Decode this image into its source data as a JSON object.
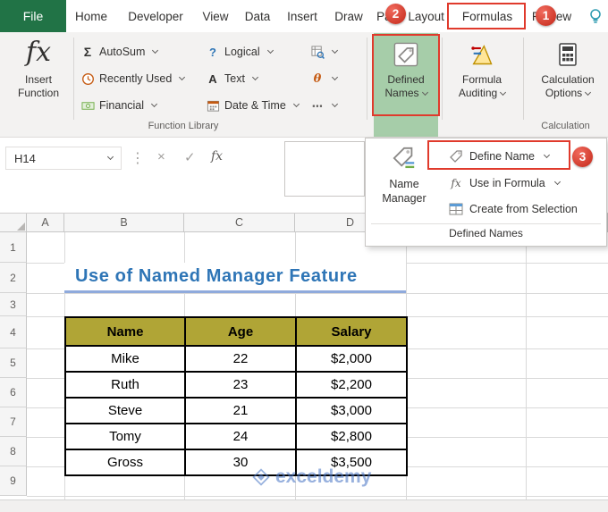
{
  "tab_bar": {
    "file_tab": "File",
    "tabs": [
      "Home",
      "Developer",
      "View",
      "Data",
      "Insert",
      "Draw",
      "Page Layout",
      "Formulas",
      "Review"
    ]
  },
  "ribbon": {
    "insert_function": {
      "glyph": "fx",
      "label": "Insert Function"
    },
    "function_library": {
      "group_label": "Function Library",
      "autosum": {
        "glyph": "Σ",
        "label": "AutoSum"
      },
      "recently_used": {
        "label": "Recently Used"
      },
      "financial": {
        "label": "Financial"
      },
      "logical": {
        "glyph": "?",
        "label": "Logical"
      },
      "text": {
        "glyph": "A",
        "label": "Text"
      },
      "date_time": {
        "label": "Date & Time"
      },
      "math_trig": {
        "glyph": "θ"
      },
      "more_functions": {
        "glyph": "⋯"
      }
    },
    "defined_names": {
      "line1": "Defined",
      "line2": "Names"
    },
    "formula_auditing": {
      "line1": "Formula",
      "line2": "Auditing"
    },
    "calculation_options": {
      "line1": "Calculation",
      "line2": "Options"
    },
    "calculation_group_label": "Calculation"
  },
  "formula_bar": {
    "name_box_value": "H14",
    "separator_glyph": "⋮",
    "cancel_glyph": "×",
    "enter_glyph": "✓",
    "fx_glyph": "fx"
  },
  "defined_names_menu": {
    "name_manager": {
      "line1": "Name",
      "line2": "Manager"
    },
    "define_name": {
      "label": "Define Name"
    },
    "use_in_formula": {
      "label": "Use in Formula",
      "glyph": "fx"
    },
    "create_from_selection": {
      "label": "Create from Selection"
    },
    "group_label": "Defined Names"
  },
  "annotations": {
    "step1": "1",
    "step2": "2",
    "step3": "3"
  },
  "worksheet": {
    "column_headers": [
      "A",
      "B",
      "C",
      "D"
    ],
    "row_headers": [
      "1",
      "2",
      "3",
      "4",
      "5",
      "6",
      "7",
      "8",
      "9"
    ],
    "title": "Use of Named Manager Feature",
    "table": {
      "headers": [
        "Name",
        "Age",
        "Salary"
      ],
      "rows": [
        [
          "Mike",
          "22",
          "$2,000"
        ],
        [
          "Ruth",
          "23",
          "$2,200"
        ],
        [
          "Steve",
          "21",
          "$3,000"
        ],
        [
          "Tomy",
          "24",
          "$2,800"
        ],
        [
          "Gross",
          "30",
          "$3,500"
        ]
      ]
    },
    "watermark": "exceldemy"
  },
  "colors": {
    "excel_green": "#217346",
    "highlight_green": "#a6cda9",
    "annotation_red": "#e03a2c",
    "table_header_fill": "#b0a536",
    "title_blue": "#2e75b6",
    "title_underline": "#8faadc"
  }
}
